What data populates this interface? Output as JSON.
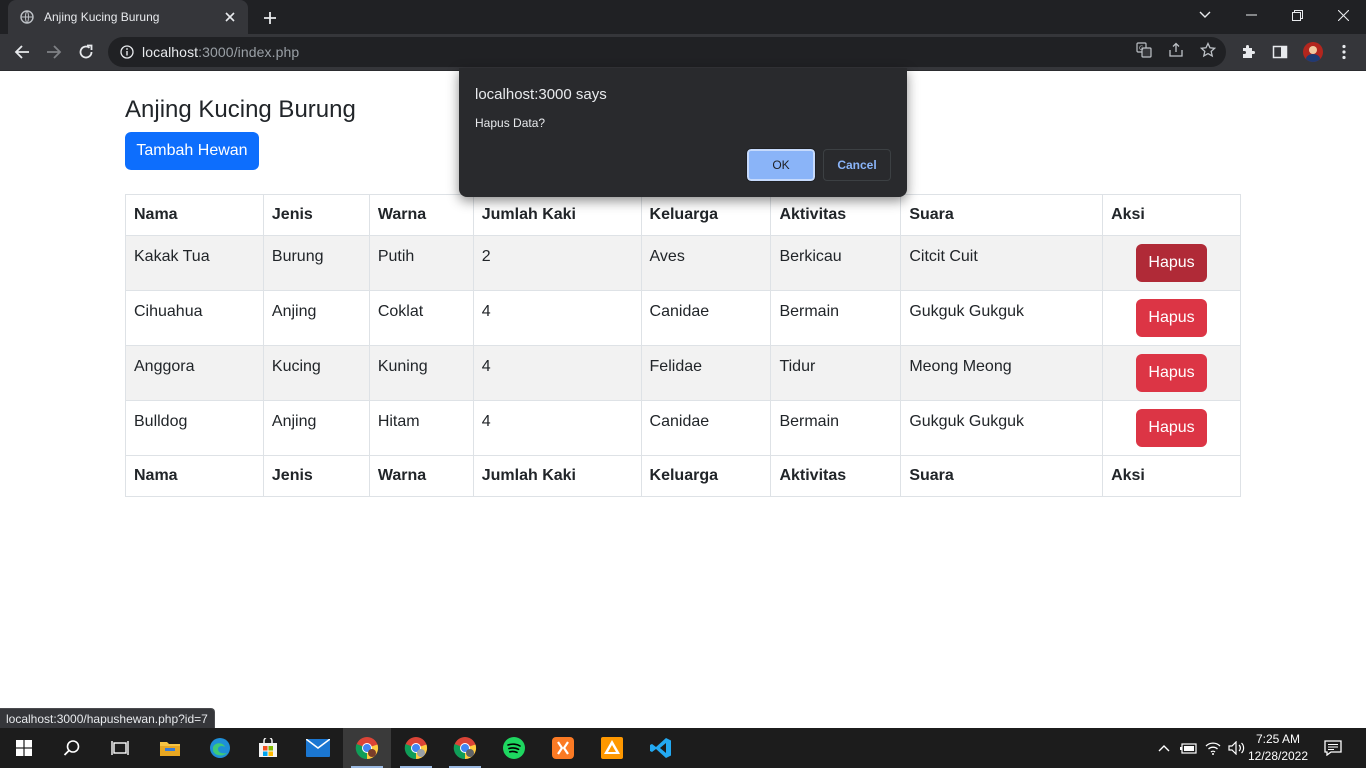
{
  "browser": {
    "tab_title": "Anjing Kucing Burung",
    "url_host": "localhost",
    "url_rest": ":3000/index.php",
    "status_url": "localhost:3000/hapushewan.php?id=7"
  },
  "page": {
    "title": "Anjing Kucing Burung",
    "add_button": "Tambah Hewan",
    "columns": [
      "Nama",
      "Jenis",
      "Warna",
      "Jumlah Kaki",
      "Keluarga",
      "Aktivitas",
      "Suara",
      "Aksi"
    ],
    "rows": [
      {
        "nama": "Kakak Tua",
        "jenis": "Burung",
        "warna": "Putih",
        "kaki": "2",
        "keluarga": "Aves",
        "aktivitas": "Berkicau",
        "suara": "Citcit Cuit",
        "aksi": "Hapus"
      },
      {
        "nama": "Cihuahua",
        "jenis": "Anjing",
        "warna": "Coklat",
        "kaki": "4",
        "keluarga": "Canidae",
        "aktivitas": "Bermain",
        "suara": "Gukguk Gukguk",
        "aksi": "Hapus"
      },
      {
        "nama": "Anggora",
        "jenis": "Kucing",
        "warna": "Kuning",
        "kaki": "4",
        "keluarga": "Felidae",
        "aktivitas": "Tidur",
        "suara": "Meong Meong",
        "aksi": "Hapus"
      },
      {
        "nama": "Bulldog",
        "jenis": "Anjing",
        "warna": "Hitam",
        "kaki": "4",
        "keluarga": "Canidae",
        "aktivitas": "Bermain",
        "suara": "Gukguk Gukguk",
        "aksi": "Hapus"
      }
    ]
  },
  "dialog": {
    "title": "localhost:3000 says",
    "message": "Hapus Data?",
    "ok": "OK",
    "cancel": "Cancel"
  },
  "taskbar": {
    "time": "7:25 AM",
    "date": "12/28/2022",
    "apps": [
      "windows-start-icon",
      "search-icon",
      "task-view-icon",
      "file-explorer-icon",
      "edge-icon",
      "store-icon",
      "mail-icon",
      "chrome-icon",
      "chrome-icon",
      "chrome-icon",
      "spotify-icon",
      "xampp-icon",
      "sublime-icon",
      "vscode-icon"
    ]
  },
  "colors": {
    "primary": "#0d6efd",
    "danger": "#dc3545",
    "danger_hover": "#b02a37",
    "dialog_accent": "#8ab4f8"
  }
}
